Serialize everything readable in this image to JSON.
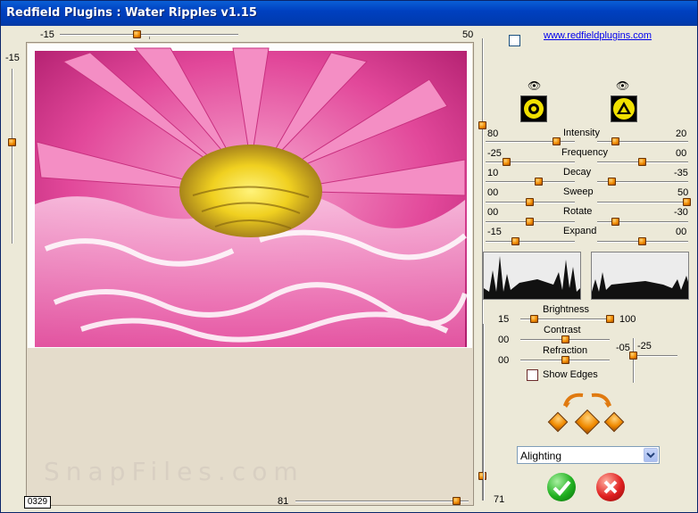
{
  "window": {
    "title": "Redfield Plugins : Water Ripples v1.15"
  },
  "link": "www.redfieldplugins.com",
  "top_slider": {
    "left": "-15",
    "right": "50"
  },
  "left_slider": {
    "value": "-15"
  },
  "bottom_slider": {
    "left": "81",
    "right": "71"
  },
  "counter": "0329",
  "watermark": "SnapFiles.com",
  "params": [
    {
      "label": "Intensity",
      "left": "80",
      "right": "20"
    },
    {
      "label": "Frequency",
      "left": "-25",
      "right": "00"
    },
    {
      "label": "Decay",
      "left": "10",
      "right": "-35"
    },
    {
      "label": "Sweep",
      "left": "00",
      "right": "50"
    },
    {
      "label": "Rotate",
      "left": "00",
      "right": "-30"
    },
    {
      "label": "Expand",
      "left": "-15",
      "right": "00"
    }
  ],
  "brightness": {
    "label": "Brightness",
    "left": "15",
    "right": "100"
  },
  "contrast": {
    "label": "Contrast",
    "value": "00"
  },
  "refraction": {
    "label": "Refraction",
    "value": "00",
    "right_a": "-05",
    "right_b": "-25"
  },
  "show_edges": {
    "label": "Show Edges",
    "checked": false
  },
  "lighting": {
    "selected": "Alighting"
  },
  "icons": {
    "eye": "eye-icon",
    "ok": "checkmark-icon",
    "cancel": "close-icon",
    "arrows": "curved-arrow-icon",
    "dice": "dice-icon"
  },
  "colors": {
    "title": "#0040c0",
    "accent": "#f08a00",
    "petal": "#e8449a",
    "center": "#f0d020"
  }
}
